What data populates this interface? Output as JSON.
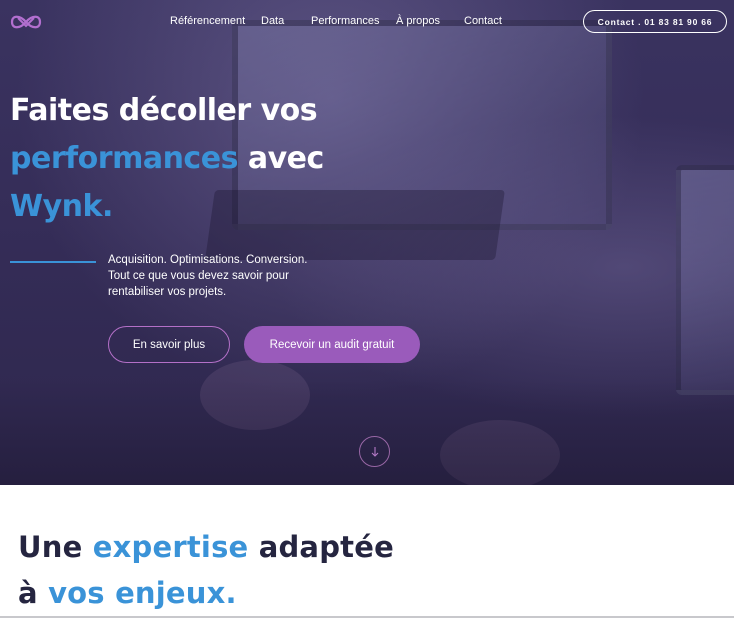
{
  "nav": {
    "logo": "wynk-logo-icon",
    "items": [
      {
        "label": "Référencement"
      },
      {
        "label": "Data"
      },
      {
        "label": "Performances"
      },
      {
        "label": "À propos"
      },
      {
        "label": "Contact"
      }
    ],
    "contact_button": "Contact . 01 83 81 90 66"
  },
  "hero": {
    "headline": {
      "line1": "Faites décoller vos",
      "line2_highlight": "performances",
      "line2_rest": " avec",
      "line3_highlight": "Wynk."
    },
    "tagline": [
      "Acquisition. Optimisations. Conversion.",
      "Tout ce que vous devez savoir pour",
      "rentabiliser vos projets."
    ],
    "primary_cta": "En savoir plus",
    "secondary_cta": "Recevoir un audit gratuit",
    "scroll_icon": "arrow-down-icon"
  },
  "section2": {
    "title": {
      "word1": "Une ",
      "word2_highlight": "expertise",
      "word3": " adaptée",
      "line2_start": "à ",
      "line2_highlight": "vos enjeux."
    }
  },
  "colors": {
    "accent_blue": "#3a93d8",
    "accent_purple": "#9a5bbb",
    "hero_bg": "#352d58",
    "dark_text": "#252540"
  }
}
